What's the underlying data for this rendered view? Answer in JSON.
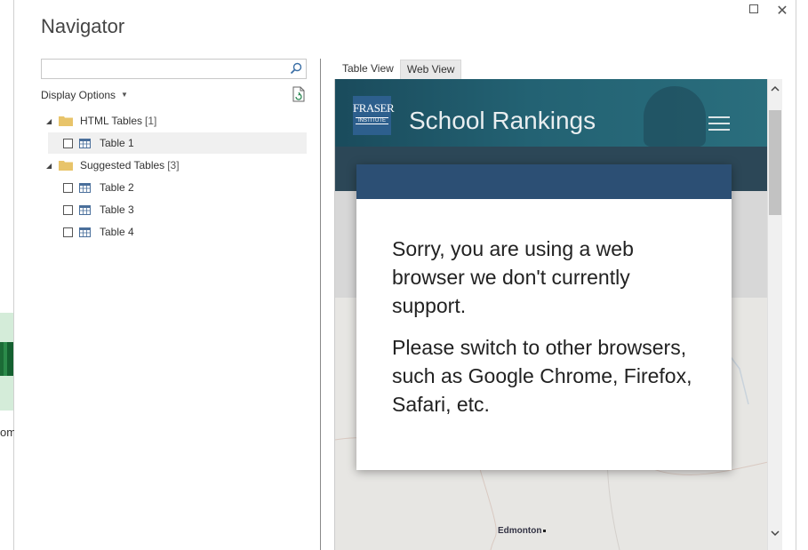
{
  "background": {
    "partial_text": "om"
  },
  "window": {
    "title": "Navigator"
  },
  "search": {
    "value": "",
    "placeholder": ""
  },
  "display_options": {
    "label": "Display Options"
  },
  "tree": {
    "groups": [
      {
        "label": "HTML Tables",
        "count": "[1]"
      },
      {
        "label": "Suggested Tables",
        "count": "[3]"
      }
    ],
    "items": [
      {
        "label": "Table 1",
        "checked": false,
        "selected": true
      },
      {
        "label": "Table 2",
        "checked": false
      },
      {
        "label": "Table 3",
        "checked": false
      },
      {
        "label": "Table 4",
        "checked": false
      }
    ]
  },
  "tabs": [
    {
      "label": "Table View",
      "active": false
    },
    {
      "label": "Web View",
      "active": true
    }
  ],
  "webview": {
    "logo_top": "FRASER",
    "logo_bottom": "INSTITUTE",
    "site_title": "School Rankings",
    "modal": {
      "line1": "Sorry, you are using a web browser we don't currently support.",
      "line2": "Please switch to other browsers, such as Google Chrome, Firefox, Safari, etc."
    },
    "map_label": "Edmonton"
  },
  "colors": {
    "header": "#236273",
    "modal_header": "#2c4f74",
    "logo_bg": "#2d5f8d",
    "folder": "#e8c46a"
  }
}
